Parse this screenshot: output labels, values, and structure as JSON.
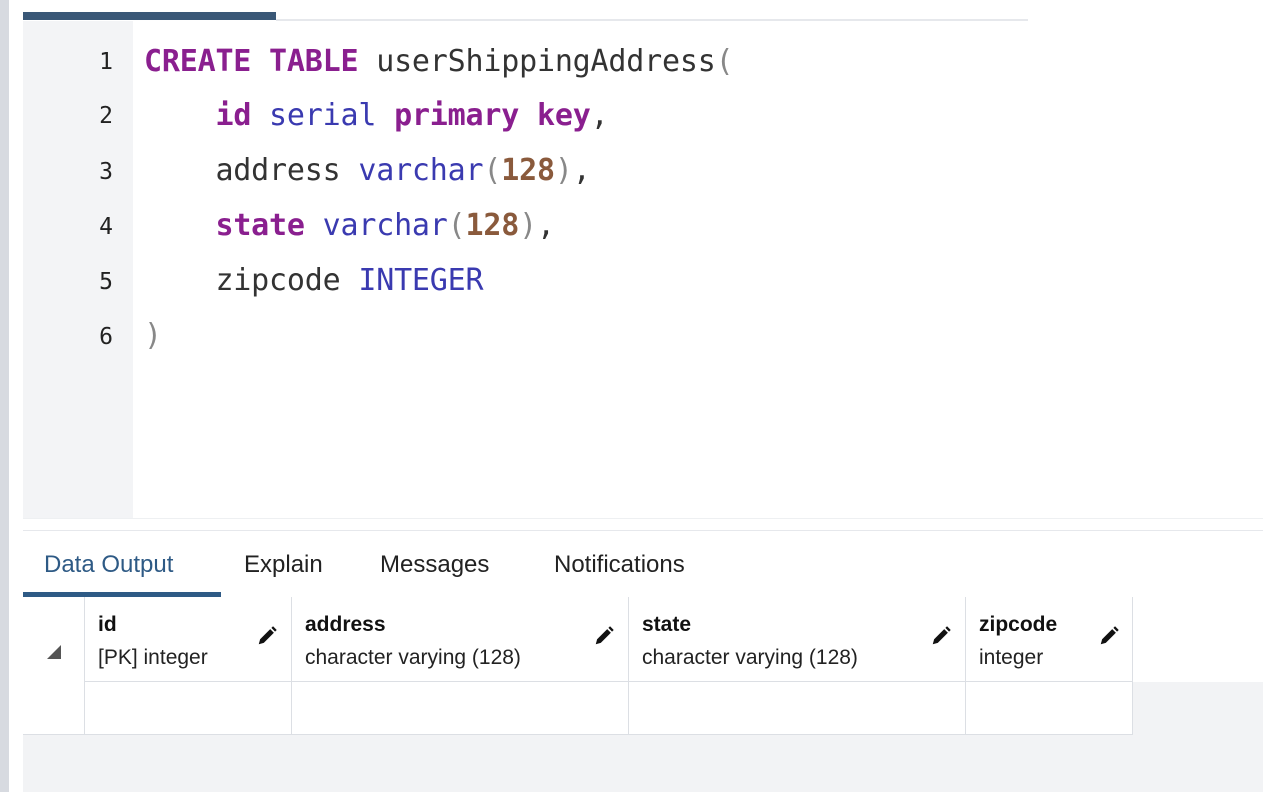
{
  "editor": {
    "line_numbers": [
      "1",
      "2",
      "3",
      "4",
      "5",
      "6"
    ],
    "lines": [
      [
        {
          "t": "CREATE TABLE",
          "c": "kw"
        },
        {
          "t": " userShippingAddress",
          "c": "plain"
        },
        {
          "t": "(",
          "c": "paren"
        }
      ],
      [
        {
          "t": "    ",
          "c": "plain"
        },
        {
          "t": "id",
          "c": "kw"
        },
        {
          "t": " serial",
          "c": "type"
        },
        {
          "t": " primary key",
          "c": "kw"
        },
        {
          "t": ",",
          "c": "plain"
        }
      ],
      [
        {
          "t": "    address ",
          "c": "plain"
        },
        {
          "t": "varchar",
          "c": "type"
        },
        {
          "t": "(",
          "c": "paren"
        },
        {
          "t": "128",
          "c": "num"
        },
        {
          "t": ")",
          "c": "paren"
        },
        {
          "t": ",",
          "c": "plain"
        }
      ],
      [
        {
          "t": "    ",
          "c": "plain"
        },
        {
          "t": "state",
          "c": "kw"
        },
        {
          "t": " varchar",
          "c": "type"
        },
        {
          "t": "(",
          "c": "paren"
        },
        {
          "t": "128",
          "c": "num"
        },
        {
          "t": ")",
          "c": "paren"
        },
        {
          "t": ",",
          "c": "plain"
        }
      ],
      [
        {
          "t": "    zipcode ",
          "c": "plain"
        },
        {
          "t": "INTEGER",
          "c": "type"
        }
      ],
      [
        {
          "t": ")",
          "c": "paren"
        }
      ]
    ]
  },
  "output": {
    "tabs": [
      "Data Output",
      "Explain",
      "Messages",
      "Notifications"
    ],
    "active_tab": "Data Output",
    "columns": [
      {
        "name": "id",
        "type": "[PK] integer"
      },
      {
        "name": "address",
        "type": "character varying (128)"
      },
      {
        "name": "state",
        "type": "character varying (128)"
      },
      {
        "name": "zipcode",
        "type": "integer"
      }
    ]
  },
  "colors": {
    "keyword": "#8a1f8f",
    "type": "#3a3ab0",
    "number": "#8a5a3c",
    "accent": "#2e5a85"
  },
  "icons": {
    "column_edit": "pencil-icon",
    "grid_corner": "corner-triangle-icon"
  }
}
